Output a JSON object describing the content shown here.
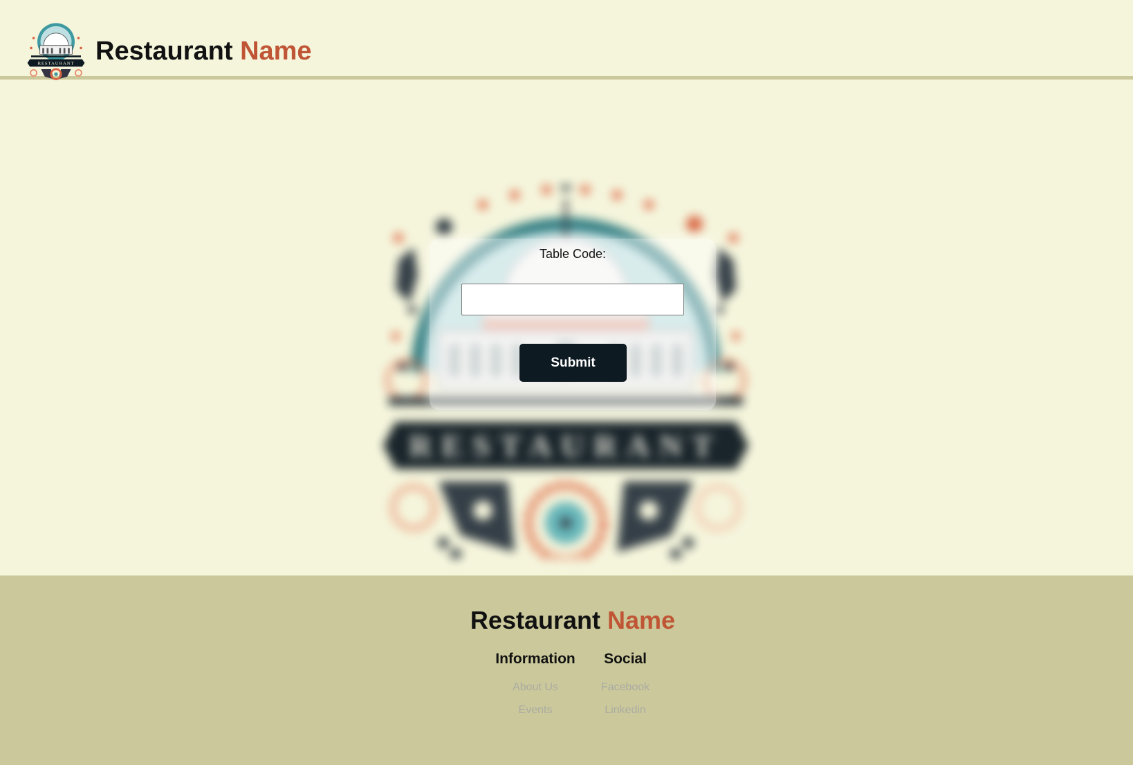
{
  "header": {
    "logo_text": "RESTAURANT",
    "title_main": "Restaurant",
    "title_accent": "Name"
  },
  "background_emblem": {
    "banner_text": "RESTAURANT"
  },
  "form": {
    "label": "Table Code:",
    "input_value": "",
    "placeholder": "",
    "submit_label": "Submit"
  },
  "footer": {
    "title_main": "Restaurant",
    "title_accent": "Name",
    "columns": [
      {
        "heading": "Information",
        "links": [
          "About Us",
          "Events"
        ]
      },
      {
        "heading": "Social",
        "links": [
          "Facebook",
          "Linkedin"
        ]
      }
    ]
  },
  "colors": {
    "background": "#f5f5dc",
    "footer_background": "#cbc99b",
    "accent": "#bf5535",
    "button": "#0e1a22",
    "teal": "#3e9aa0",
    "link_muted": "#a9aaa2"
  },
  "icons": [
    "restaurant-logo-icon",
    "restaurant-emblem-icon"
  ]
}
